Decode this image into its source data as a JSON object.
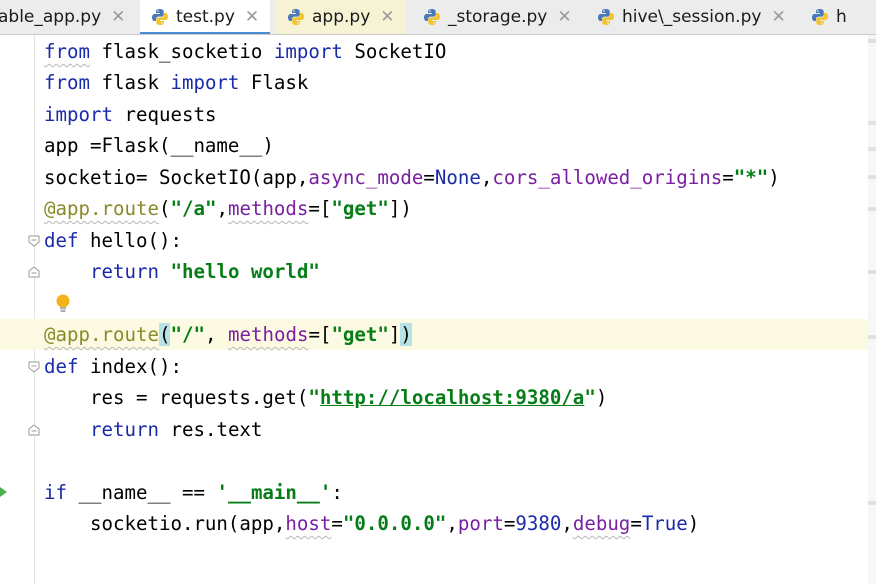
{
  "tabs": [
    {
      "label": "able_app.py",
      "icon": "python-file-icon",
      "closable": true,
      "active": false
    },
    {
      "label": "test.py",
      "icon": "python-file-icon",
      "closable": true,
      "active": true
    },
    {
      "label": "app.py",
      "icon": "python-file-icon",
      "closable": true,
      "active": false
    },
    {
      "label": "_storage.py",
      "icon": "python-file-icon",
      "closable": true,
      "active": false
    },
    {
      "label": "hive\\_session.py",
      "icon": "python-file-icon",
      "closable": true,
      "active": false
    },
    {
      "label": "h",
      "icon": "python-file-icon",
      "closable": false,
      "active": false
    }
  ],
  "close_glyph": "✕",
  "code": {
    "l1": {
      "a": "from",
      "b": " flask_socketio ",
      "c": "import",
      "d": " SocketIO"
    },
    "l2": {
      "a": "from",
      "b": " flask ",
      "c": "import",
      "d": " Flask"
    },
    "l3": {
      "a": "import",
      "b": " requests"
    },
    "l4": {
      "a": "app =Flask(__name__)"
    },
    "l5": {
      "a": "socketio= SocketIO(app,",
      "b": "async_mode",
      "c": "=",
      "d": "None",
      "e": ",",
      "f": "cors_allowed_origins",
      "g": "=",
      "h": "\"*\"",
      "i": ")"
    },
    "l6": {
      "a": "@app.route",
      "b": "(",
      "c": "\"/a\"",
      "d": ",",
      "e": "methods",
      "f": "=[",
      "g": "\"get\"",
      "h": "])"
    },
    "l7": {
      "a": "def",
      "b": " hello():"
    },
    "l8": {
      "a": "    ",
      "b": "return",
      "c": " ",
      "d": "\"hello world\""
    },
    "l10": {
      "a": "@app.route",
      "b": "(",
      "c": "\"/\"",
      "d": ", ",
      "e": "methods",
      "f": "=[",
      "g": "\"get\"",
      "h": "]",
      "i": ")"
    },
    "l11": {
      "a": "def",
      "b": " index():"
    },
    "l12": {
      "a": "    res = requests.get(",
      "b": "\"",
      "c": "http://localhost:9380/a",
      "d": "\"",
      "e": ")"
    },
    "l13": {
      "a": "    ",
      "b": "return",
      "c": " res.text"
    },
    "l15": {
      "a": "if",
      "b": " __name__ == ",
      "c": "'__main__'",
      "d": ":"
    },
    "l16": {
      "a": "    socketio.run(app,",
      "b": "host",
      "c": "=",
      "d": "\"0.0.0.0\"",
      "e": ",",
      "f": "port",
      "g": "=",
      "h": "9380",
      "i": ",",
      "j": "debug",
      "k": "=",
      "l": "True",
      "m": ")"
    }
  },
  "colors": {
    "keyword": "#1a2ba8",
    "string": "#067d17",
    "parameter": "#7a1fa2",
    "current_line": "#fcfae3",
    "active_tab_underline": "#4b8cd6"
  }
}
